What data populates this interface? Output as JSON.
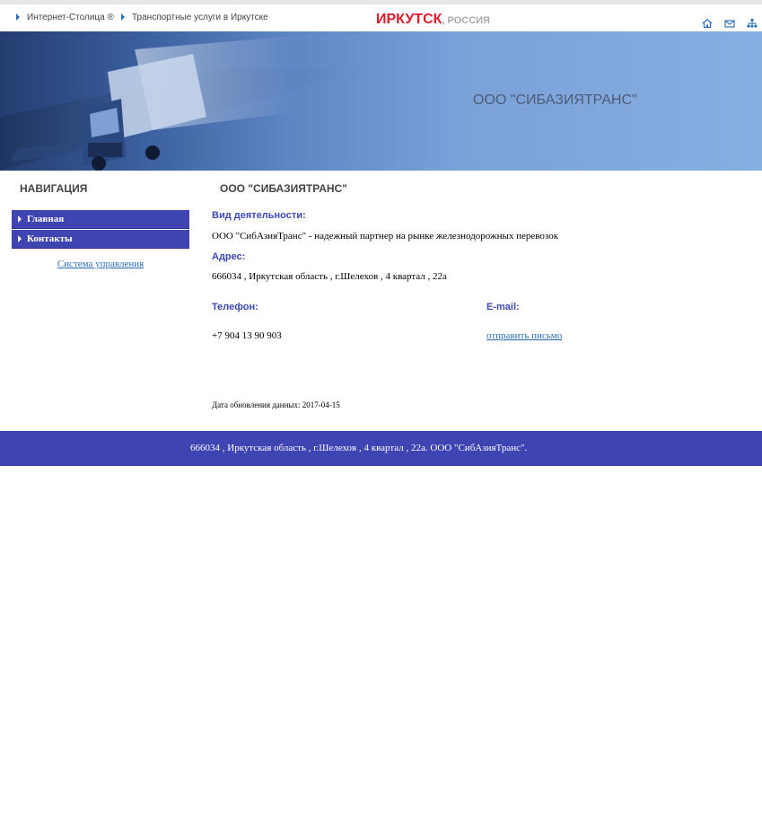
{
  "header": {
    "crumbs": [
      "Интернет-Столица ®",
      "Транспортные услуги в Иркутске"
    ],
    "city": "ИРКУТСК",
    "country": ", РОССИЯ",
    "icons": [
      "home-icon",
      "mail-icon",
      "sitemap-icon"
    ],
    "accent_color": "#e11d2b",
    "link_color": "#2a6db6"
  },
  "banner": {
    "title": "ООО \"СИБАЗИЯТРАНС\""
  },
  "sidebar": {
    "heading": "НАВИГАЦИЯ",
    "items": [
      {
        "label": "Главная"
      },
      {
        "label": "Контакты"
      }
    ],
    "admin_link": "Система управления",
    "menu_color": "#3f44b3"
  },
  "main": {
    "heading": "ООО \"СИБАЗИЯТРАНС\"",
    "activity_label": "Вид деятельности:",
    "activity_text": "ООО \"СибАзияТранс\" - надежный партнер на рынке железнодорожных перевозок",
    "address_label": "Адрес:",
    "address_text": "666034 , Иркутская область , г.Шелехов , 4 квартал , 22а",
    "phone_label": "Телефон:",
    "phone_value": "+7 904 13 90 903",
    "email_label": "E-mail:",
    "email_link": "отправить письмо",
    "update_text": "Дата обновления данных: 2017-04-15",
    "label_color": "#3d48b0"
  },
  "footer": {
    "text": "666034 , Иркутская область , г.Шелехов , 4 квартал , 22а. ООО \"СибАзияТранс\"."
  }
}
